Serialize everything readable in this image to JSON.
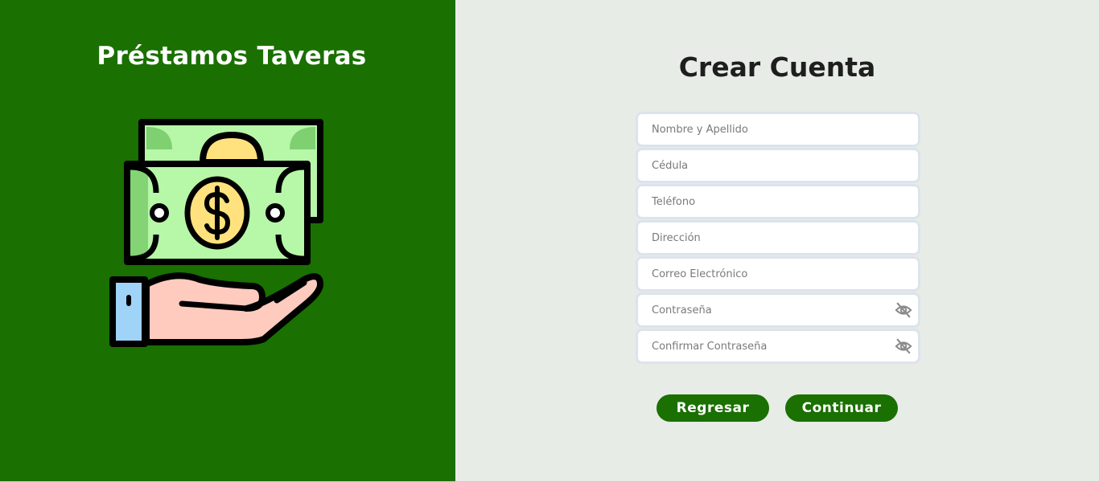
{
  "brand": {
    "title": "Préstamos Taveras"
  },
  "form": {
    "title": "Crear Cuenta",
    "fields": [
      {
        "placeholder": "Nombre y Apellido",
        "value": ""
      },
      {
        "placeholder": "Cédula",
        "value": ""
      },
      {
        "placeholder": "Teléfono",
        "value": ""
      },
      {
        "placeholder": "Dirección",
        "value": ""
      },
      {
        "placeholder": "Correo Electrónico",
        "value": ""
      },
      {
        "placeholder": "Contraseña",
        "value": "",
        "icon": "eye-slash-icon"
      },
      {
        "placeholder": "Confirmar Contraseña",
        "value": "",
        "icon": "eye-slash-icon"
      }
    ],
    "buttons": {
      "back_label": "Regresar",
      "continue_label": "Continuar"
    }
  },
  "colors": {
    "brand_green": "#1a7000",
    "panel_background": "#e7ece7",
    "title_text": "#1e1e1e"
  }
}
